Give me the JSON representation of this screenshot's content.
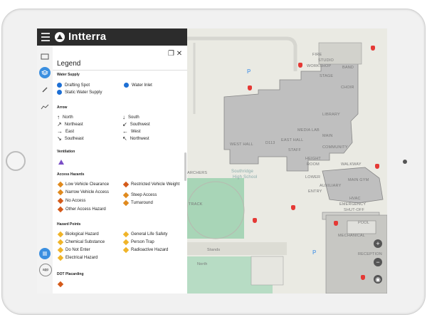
{
  "app": {
    "name": "Intterra"
  },
  "legend": {
    "title": "Legend",
    "sections": {
      "water_supply": {
        "title": "Water Supply",
        "items": [
          "Drafting Spot",
          "Water Inlet",
          "Static Water Supply"
        ]
      },
      "arrow": {
        "title": "Arrow",
        "items": [
          "North",
          "South",
          "Northeast",
          "Southwest",
          "East",
          "West",
          "Southeast",
          "Northwest"
        ]
      },
      "ventilation": {
        "title": "Ventilation"
      },
      "access_hazards": {
        "title": "Access Hazards",
        "items": [
          "Low Vehicle Clearance",
          "Restricted Vehicle Weight",
          "Narrow Vehicle Access",
          "Steep Access",
          "No Access",
          "Turnaround",
          "Other Access Hazard"
        ]
      },
      "hazard_points": {
        "title": "Hazard Points",
        "items": [
          "Biological Hazard",
          "General Life Safety",
          "Chemical Substance",
          "Person Trap",
          "Do Not Enter",
          "Radioactive Hazard",
          "Electrical Hazard"
        ]
      },
      "dot": {
        "title": "DOT Placarding"
      }
    }
  },
  "rail": {
    "app_label": "app"
  },
  "map": {
    "labels": [
      "FIRE",
      "STUDIO",
      "WORKSHOP",
      "BAND",
      "STAGE",
      "CHOIR",
      "LIBRARY",
      "MEDIA LAB",
      "D113",
      "WEST HALL",
      "EAST HALL",
      "MAIN",
      "STAFF",
      "COMMUNITY",
      "HEIGHT",
      "ROOM",
      "WALKWAY",
      "Southridge",
      "High School",
      "LOWER",
      "AUXILIARY",
      "MAIN GYM",
      "ENTRY",
      "HVAC",
      "EMERGENCY",
      "SHUT-OFF",
      "POOL",
      "MECHANICAL",
      "RECEPTION",
      "Stands",
      "North",
      "TRACK",
      "ARCHERS"
    ],
    "parking_label": "P",
    "zoom_in": "+",
    "zoom_out": "−"
  },
  "colors": {
    "header": "#2c2c2c",
    "accent": "#3b8fe0",
    "map_bg": "#eaeae3",
    "building": "#bfbfbf",
    "field": "#a8d5b7"
  }
}
